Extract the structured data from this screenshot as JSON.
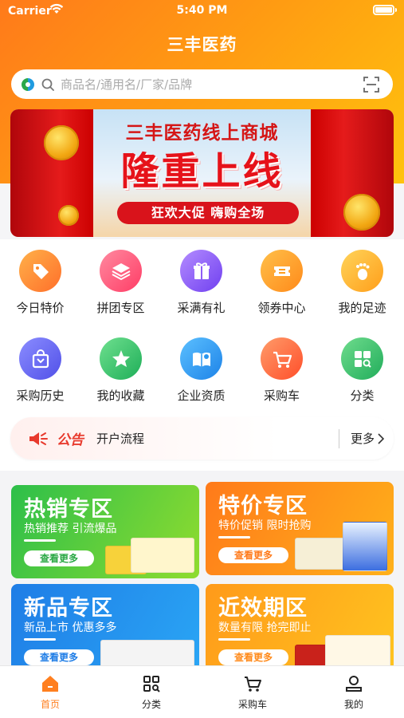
{
  "status_bar": {
    "carrier": "Carrier",
    "time": "5:40 PM"
  },
  "header": {
    "title": "三丰医药"
  },
  "search": {
    "placeholder": "商品名/通用名/厂家/品牌"
  },
  "banner": {
    "line1": "三丰医药线上商城",
    "line2": "隆重上线",
    "line3": "狂欢大促 嗨购全场"
  },
  "quick_menu": [
    {
      "label": "今日特价",
      "icon": "price-tag-icon",
      "color": "#ff8a2a"
    },
    {
      "label": "拼团专区",
      "icon": "layers-icon",
      "color": "#ff5c7a"
    },
    {
      "label": "采满有礼",
      "icon": "gift-icon",
      "color": "#8f5cf6"
    },
    {
      "label": "领券中心",
      "icon": "coupon-icon",
      "color": "#ff9e1f"
    },
    {
      "label": "我的足迹",
      "icon": "footprint-icon",
      "color": "#ffb31f"
    },
    {
      "label": "采购历史",
      "icon": "bag-icon",
      "color": "#6d6ff5"
    },
    {
      "label": "我的收藏",
      "icon": "star-icon",
      "color": "#2cc46a"
    },
    {
      "label": "企业资质",
      "icon": "certificate-book-icon",
      "color": "#2a97f0"
    },
    {
      "label": "采购车",
      "icon": "cart-icon",
      "color": "#ff6a3d"
    },
    {
      "label": "分类",
      "icon": "category-grid-icon",
      "color": "#2fbf6b"
    }
  ],
  "notice": {
    "tag": "公告",
    "text": "开户流程",
    "more": "更多"
  },
  "zones": [
    {
      "title": "热销专区",
      "subtitle": "热销推荐 引流爆品",
      "button": "查看更多",
      "color_from": "#2dbf4a",
      "color_to": "#8fdc2f",
      "text_color": "#2aa844"
    },
    {
      "title": "特价专区",
      "subtitle": "特价促销 限时抢购",
      "button": "查看更多",
      "color_from": "#ff7a1a",
      "color_to": "#ffb11a",
      "text_color": "#ff7a1a"
    },
    {
      "title": "新品专区",
      "subtitle": "新品上市 优惠多多",
      "button": "查看更多",
      "color_from": "#1f7de6",
      "color_to": "#2aa6f5",
      "text_color": "#1f7de6"
    },
    {
      "title": "近效期区",
      "subtitle": "数量有限 抢完即止",
      "button": "查看更多",
      "color_from": "#ff9a1a",
      "color_to": "#ffc41f",
      "text_color": "#ff8a1a"
    }
  ],
  "tabbar": [
    {
      "label": "首页",
      "icon": "home-icon",
      "active": true
    },
    {
      "label": "分类",
      "icon": "category-icon",
      "active": false
    },
    {
      "label": "采购车",
      "icon": "cart-icon",
      "active": false
    },
    {
      "label": "我的",
      "icon": "user-icon",
      "active": false
    }
  ],
  "colors": {
    "brand_orange": "#ff8a1a",
    "active_tab": "#ff7f1f"
  }
}
